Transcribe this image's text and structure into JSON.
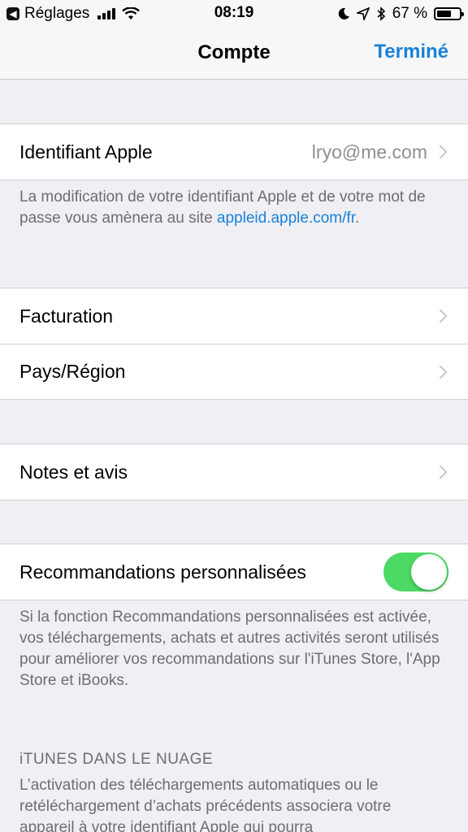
{
  "status_bar": {
    "back_label": "Réglages",
    "time": "08:19",
    "battery_text": "67 %",
    "battery_level": 0.67
  },
  "nav": {
    "title": "Compte",
    "done_label": "Terminé"
  },
  "apple_id": {
    "label": "Identifiant Apple",
    "value": "lryo@me.com",
    "footer_text": "La modification de votre identifiant Apple et de votre mot de passe vous amènera au site ",
    "footer_link": "appleid.apple.com/fr",
    "footer_end": "."
  },
  "billing": {
    "items": [
      {
        "label": "Facturation"
      },
      {
        "label": "Pays/Région"
      }
    ]
  },
  "ratings": {
    "label": "Notes et avis"
  },
  "recommendations": {
    "label": "Recommandations personnalisées",
    "enabled": true,
    "footer": "Si la fonction Recommandations personnalisées est activée, vos téléchargements, achats et autres activités seront utilisés pour améliorer vos recommandations sur l'iTunes Store, l'App Store et iBooks."
  },
  "itunes_cloud": {
    "header": "iTUNES DANS LE NUAGE",
    "text": "L’activation des téléchargements automatiques ou le retéléchargement d’achats précédents associera votre appareil à votre identifiant Apple qui pourra"
  },
  "colors": {
    "accent": "#1a82d8",
    "toggle_on": "#4cd964",
    "background": "#efeff4"
  }
}
